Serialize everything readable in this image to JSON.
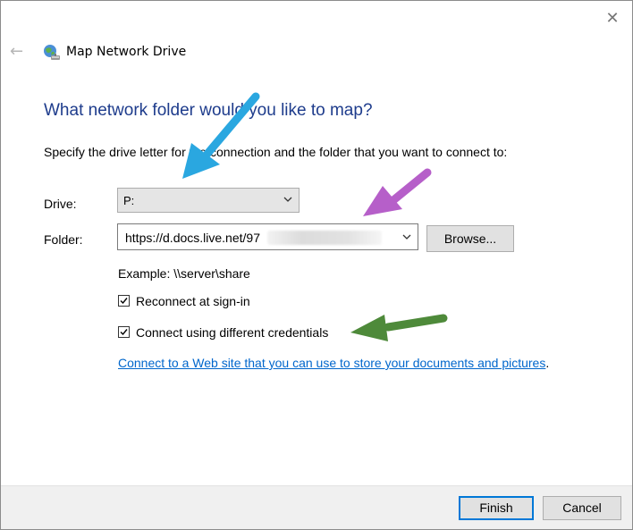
{
  "window": {
    "title": "Map Network Drive",
    "close_icon": "close-icon",
    "back_icon": "back-arrow-icon",
    "app_icon": "network-drive-icon"
  },
  "content": {
    "heading": "What network folder would you like to map?",
    "instructions": "Specify the drive letter for the connection and the folder that you want to connect to:",
    "drive_label": "Drive:",
    "drive_value": "P:",
    "folder_label": "Folder:",
    "folder_value": "https://d.docs.live.net/97",
    "browse_label": "Browse...",
    "example_text": "Example: \\\\server\\share",
    "reconnect_label": "Reconnect at sign-in",
    "reconnect_checked": true,
    "credentials_label": "Connect using different credentials",
    "credentials_checked": true,
    "link_text": "Connect to a Web site that you can use to store your documents and pictures",
    "link_suffix": "."
  },
  "footer": {
    "finish_label": "Finish",
    "cancel_label": "Cancel"
  },
  "annotations": {
    "arrow_colors": {
      "blue": "#2aa7e0",
      "purple": "#b65fc9",
      "green": "#4e8a3a"
    }
  }
}
